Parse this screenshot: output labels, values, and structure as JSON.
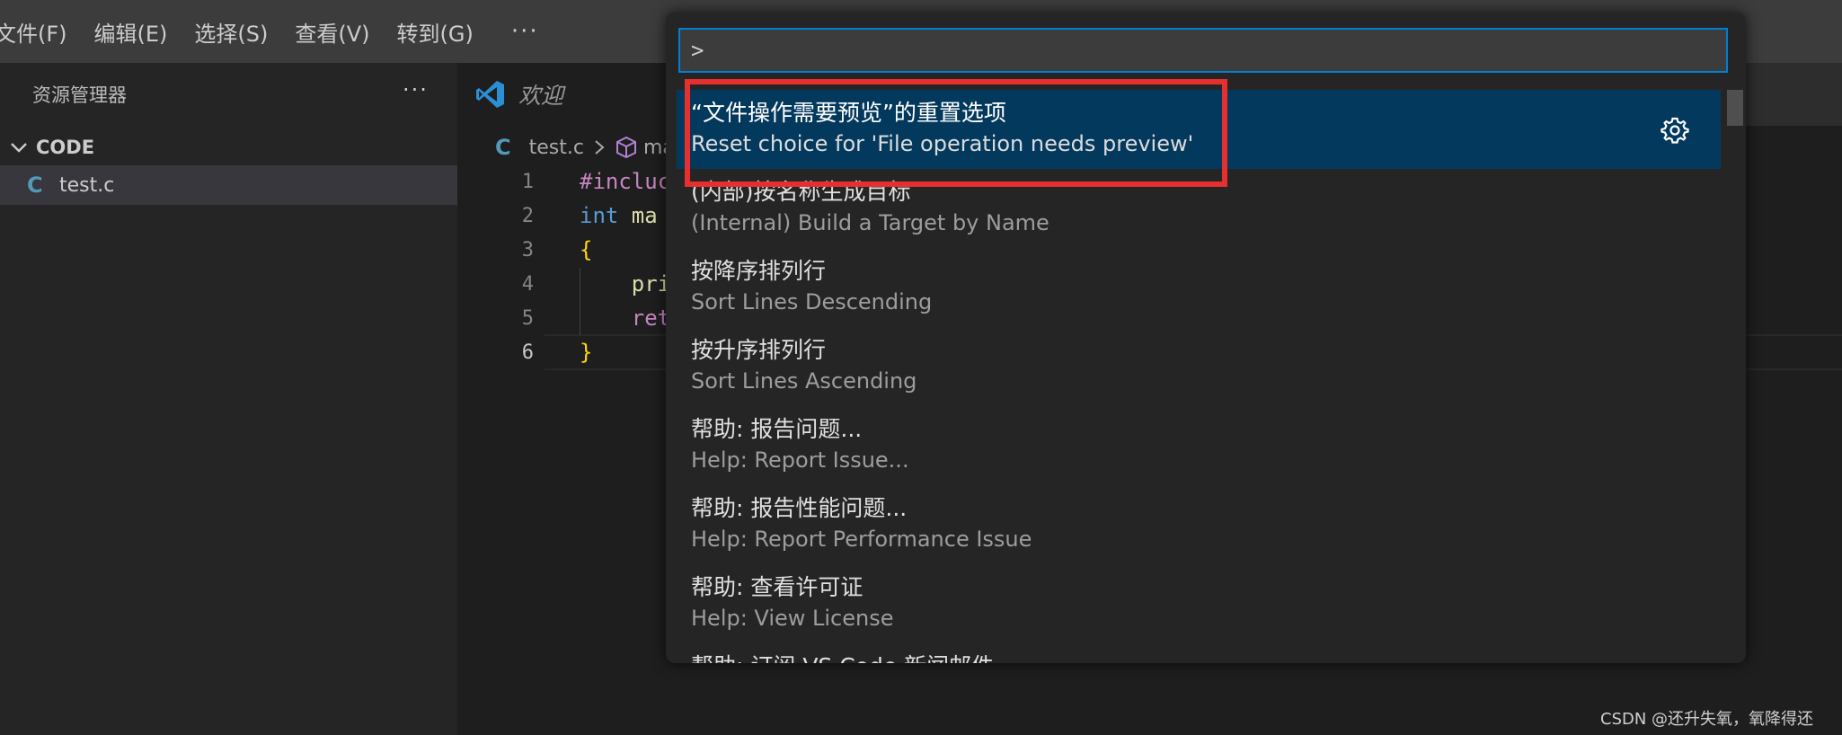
{
  "menubar": {
    "items": [
      "文件(F)",
      "编辑(E)",
      "选择(S)",
      "查看(V)",
      "转到(G)"
    ],
    "more": "···"
  },
  "sidebar": {
    "title": "资源管理器",
    "more": "···",
    "folder": "CODE",
    "file_icon": "C",
    "file": "test.c"
  },
  "editor": {
    "tab_label": "欢迎",
    "breadcrumb": {
      "file_icon": "C",
      "file": "test.c",
      "symbol": "ma"
    },
    "line_numbers": [
      "1",
      "2",
      "3",
      "4",
      "5",
      "6"
    ],
    "code": {
      "l1": "#incluc",
      "l2_kw": "int",
      "l2_rest": " ma",
      "l3": "{",
      "l4": "    pri",
      "l5": "    ret",
      "l6": "}"
    }
  },
  "palette": {
    "input_value": ">",
    "items": [
      {
        "title": "“文件操作需要预览”的重置选项",
        "subtitle": "Reset choice for 'File operation needs preview'"
      },
      {
        "title": "(内部)按名称生成目标",
        "subtitle": "(Internal) Build a Target by Name"
      },
      {
        "title": "按降序排列行",
        "subtitle": "Sort Lines Descending"
      },
      {
        "title": "按升序排列行",
        "subtitle": "Sort Lines Ascending"
      },
      {
        "title": "帮助: 报告问题...",
        "subtitle": "Help: Report Issue..."
      },
      {
        "title": "帮助: 报告性能问题...",
        "subtitle": "Help: Report Performance Issue"
      },
      {
        "title": "帮助: 查看许可证",
        "subtitle": "Help: View License"
      },
      {
        "title": "帮助: 订阅 VS Code 新闻邮件",
        "subtitle": ""
      }
    ]
  },
  "watermark": "CSDN @还升失氧，氧降得还",
  "colors": {
    "accent": "#007fd4",
    "selection": "#04395e",
    "annotation": "#e63030"
  },
  "icons": [
    "chevron-down-icon",
    "c-file-icon",
    "vscode-logo-icon",
    "cube-symbol-icon",
    "gear-icon"
  ]
}
